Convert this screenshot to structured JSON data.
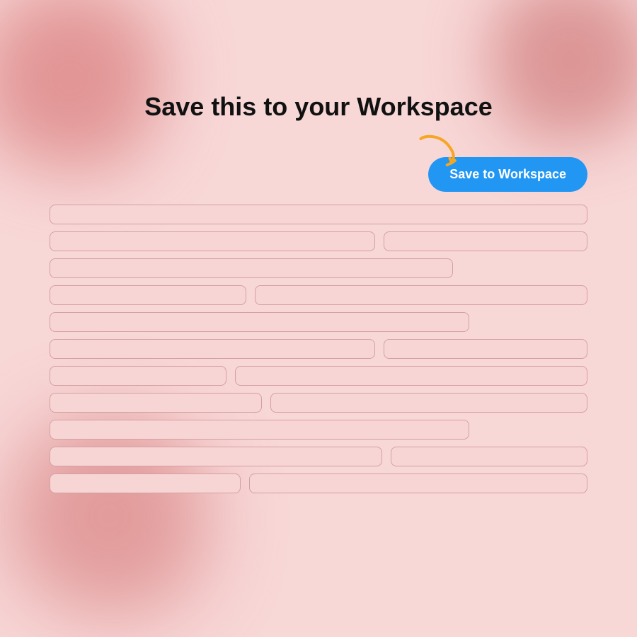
{
  "title": "Save this to your Workspace",
  "button": {
    "label": "Save to Workspace"
  },
  "arrow": "↙",
  "background": {
    "color": "#f8d7d7"
  }
}
